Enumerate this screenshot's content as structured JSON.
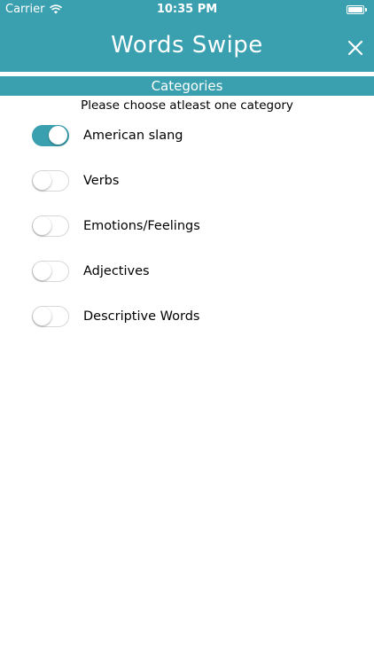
{
  "status_bar": {
    "carrier": "Carrier",
    "time": "10:35 PM"
  },
  "nav": {
    "title": "Words Swipe"
  },
  "section": {
    "title": "Categories",
    "instruction": "Please choose atleast one category"
  },
  "categories": [
    {
      "label": "American slang",
      "enabled": true
    },
    {
      "label": "Verbs",
      "enabled": false
    },
    {
      "label": "Emotions/Feelings",
      "enabled": false
    },
    {
      "label": "Adjectives",
      "enabled": false
    },
    {
      "label": "Descriptive Words",
      "enabled": false
    }
  ],
  "colors": {
    "accent": "#3a9fae",
    "toggle_off_border": "#d8d8d8",
    "background": "#ffffff"
  },
  "icons": {
    "wifi": "wifi-icon",
    "battery": "battery-icon",
    "close": "close-icon"
  }
}
